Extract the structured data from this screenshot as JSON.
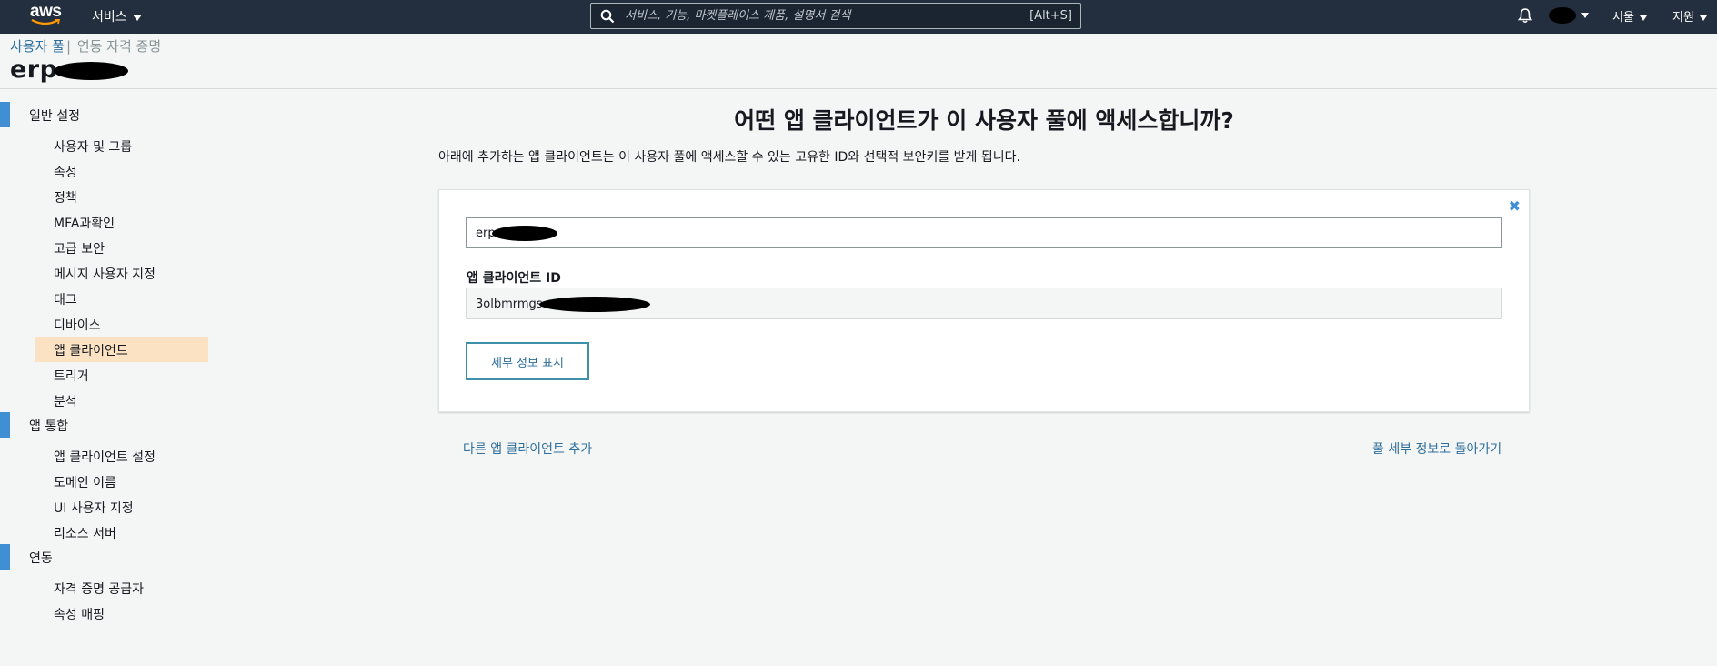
{
  "topbar": {
    "logo_text": "aws",
    "services_label": "서비스",
    "search_placeholder": "서비스, 기능, 마켓플레이스 제품, 설명서 검색",
    "search_shortcut": "[Alt+S]",
    "region_label": "서울",
    "support_label": "지원",
    "colors": {
      "background": "#232f3e",
      "logo_smile": "#ff9900"
    }
  },
  "breadcrumb": {
    "link": "사용자 풀",
    "separator": "|",
    "current": "연동 자격 증명"
  },
  "header": {
    "pool_name_visible": "erp"
  },
  "sidebar": {
    "sections": [
      {
        "label": "일반 설정",
        "items": [
          "사용자 및 그룹",
          "속성",
          "정책",
          "MFA과확인",
          "고급 보안",
          "메시지 사용자 지정",
          "태그",
          "디바이스",
          "앱 클라이언트",
          "트리거",
          "분석"
        ]
      },
      {
        "label": "앱 통합",
        "items": [
          "앱 클라이언트 설정",
          "도메인 이름",
          "UI 사용자 지정",
          "리소스 서버"
        ]
      },
      {
        "label": "연동",
        "items": [
          "자격 증명 공급자",
          "속성 매핑"
        ]
      }
    ],
    "active_item": "앱 클라이언트",
    "colors": {
      "marker": "#3f8fd2",
      "active_bg": "#fbe2c3"
    }
  },
  "main": {
    "title": "어떤 앱 클라이언트가 이 사용자 풀에 액세스합니까?",
    "description": "아래에 추가하는 앱 클라이언트는 이 사용자 풀에 액세스할 수 있는 고유한 ID와 선택적 보안키를 받게 됩니다.",
    "card": {
      "client_name_visible": "erp",
      "client_id_label": "앱 클라이언트 ID",
      "client_id_visible": "3olbmrmgs",
      "detail_button": "세부 정보 표시",
      "close_symbol": "✖"
    },
    "add_client_link": "다른 앱 클라이언트 추가",
    "back_link": "풀 세부 정보로 돌아가기"
  }
}
